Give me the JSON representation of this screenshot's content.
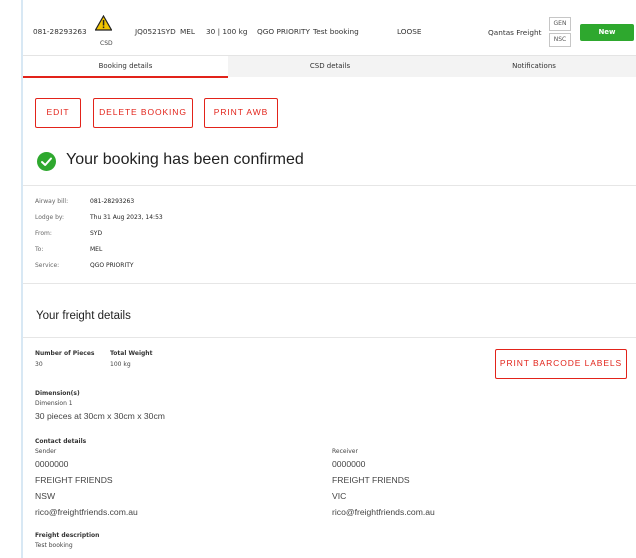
{
  "summary": {
    "awb": "081-28293263",
    "csd_label": "CSD",
    "flight": "JQ0521",
    "origin": "SYD",
    "dest": "MEL",
    "pieces_weight": "30 | 100 kg",
    "service": "QGO PRIORITY",
    "description": "Test booking",
    "type": "LOOSE",
    "carrier": "Qantas Freight",
    "code_gen": "GEN",
    "code_nsc": "NSC",
    "status_button": "New"
  },
  "tabs": [
    {
      "label": "Booking details"
    },
    {
      "label": "CSD details"
    },
    {
      "label": "Notifications"
    }
  ],
  "actions": {
    "edit": "EDIT",
    "delete": "DELETE BOOKING",
    "print_awb": "PRINT AWB"
  },
  "confirmation": {
    "title": "Your booking has been confirmed"
  },
  "booking_info": [
    {
      "label": "Airway bill:",
      "value": "081-28293263"
    },
    {
      "label": "Lodge by:",
      "value": "Thu 31 Aug 2023, 14:53"
    },
    {
      "label": "From:",
      "value": "SYD"
    },
    {
      "label": "To:",
      "value": "MEL"
    },
    {
      "label": "Service:",
      "value": "QGO PRIORITY"
    }
  ],
  "freight": {
    "title": "Your freight details",
    "pieces_label": "Number of Pieces",
    "pieces_value": "30",
    "weight_label": "Total Weight",
    "weight_value": "100 kg",
    "print_barcode": "PRINT BARCODE LABELS",
    "dimensions_label": "Dimension(s)",
    "dimension_1_label": "Dimension 1",
    "dimension_1_value": "30 pieces at 30cm x 30cm x 30cm",
    "contact_label": "Contact details",
    "sender": {
      "label": "Sender",
      "phone": "0000000",
      "name": "FREIGHT FRIENDS",
      "state": "NSW",
      "email": "rico@freightfriends.com.au"
    },
    "receiver": {
      "label": "Receiver",
      "phone": "0000000",
      "name": "FREIGHT FRIENDS",
      "state": "VIC",
      "email": "rico@freightfriends.com.au"
    },
    "description_label": "Freight description",
    "description_value": "Test booking"
  },
  "colors": {
    "accent_red": "#e2231a",
    "success_green": "#2ea82e",
    "warning_yellow": "#f2c500"
  },
  "icons": [
    "warning-icon",
    "check-circle-icon"
  ]
}
